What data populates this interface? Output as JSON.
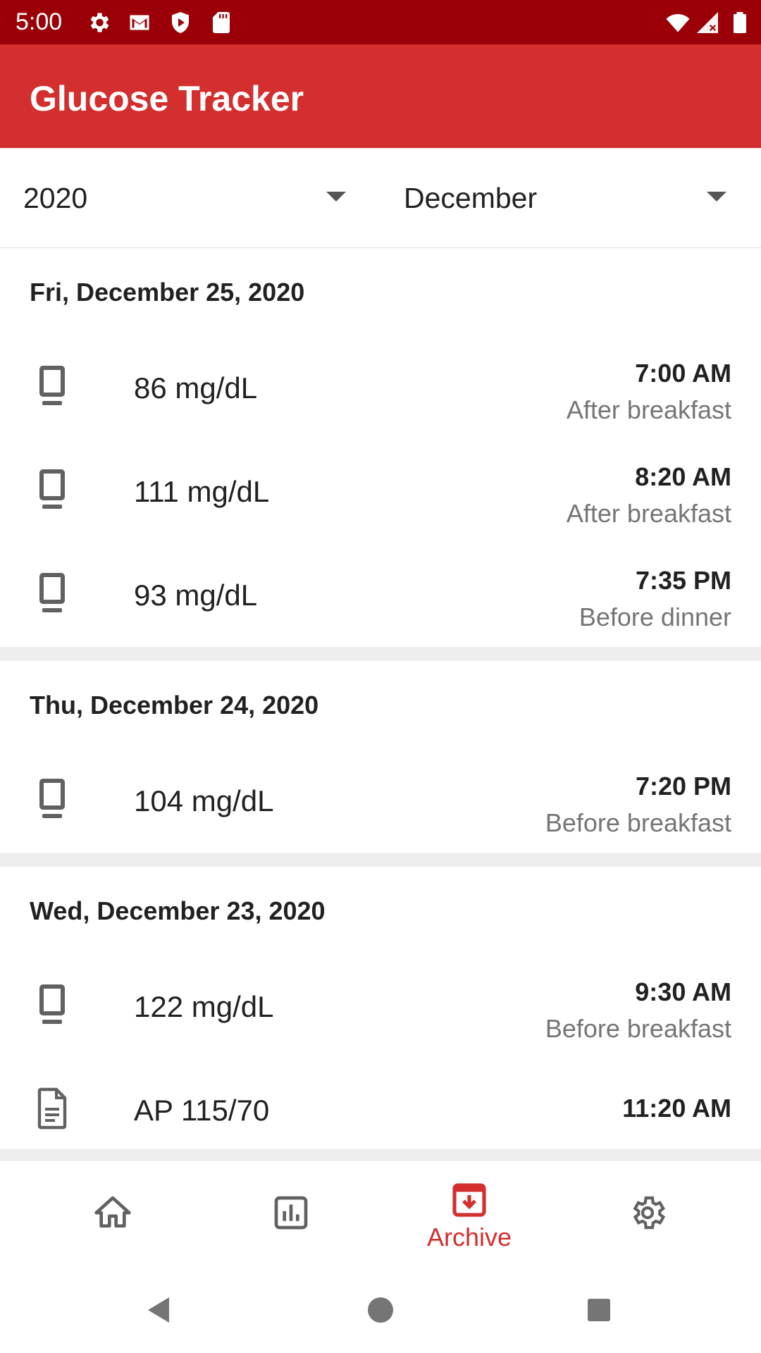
{
  "status_bar": {
    "time": "5:00",
    "left_icons": [
      "settings-icon",
      "gmail-icon",
      "shield-icon",
      "sd-card-icon"
    ],
    "right_icons": [
      "wifi-icon",
      "cell-signal-icon",
      "battery-icon"
    ]
  },
  "app_bar": {
    "title": "Glucose Tracker",
    "color": "#d32f2f",
    "status_color": "#9b0008"
  },
  "filters": {
    "year": "2020",
    "month": "December"
  },
  "days": [
    {
      "date": "Fri, December 25, 2020",
      "entries": [
        {
          "icon": "device-icon",
          "reading": "86 mg/dL",
          "time": "7:00 AM",
          "meal": "After breakfast"
        },
        {
          "icon": "device-icon",
          "reading": "111 mg/dL",
          "time": "8:20 AM",
          "meal": "After breakfast"
        },
        {
          "icon": "device-icon",
          "reading": "93 mg/dL",
          "time": "7:35 PM",
          "meal": "Before dinner"
        }
      ]
    },
    {
      "date": "Thu, December 24, 2020",
      "entries": [
        {
          "icon": "device-icon",
          "reading": "104 mg/dL",
          "time": "7:20 PM",
          "meal": "Before breakfast"
        }
      ]
    },
    {
      "date": "Wed, December 23, 2020",
      "entries": [
        {
          "icon": "device-icon",
          "reading": "122 mg/dL",
          "time": "9:30 AM",
          "meal": "Before breakfast"
        },
        {
          "icon": "document-icon",
          "reading": "AP 115/70",
          "time": "11:20 AM",
          "meal": ""
        }
      ]
    }
  ],
  "bottom_nav": {
    "items": [
      {
        "icon": "home-icon",
        "label": ""
      },
      {
        "icon": "chart-icon",
        "label": ""
      },
      {
        "icon": "archive-icon",
        "label": "Archive",
        "active": true
      },
      {
        "icon": "settings-icon",
        "label": ""
      }
    ],
    "active_color": "#d32f2f"
  },
  "system_nav": [
    "back-icon",
    "home-circle-icon",
    "recents-icon"
  ]
}
